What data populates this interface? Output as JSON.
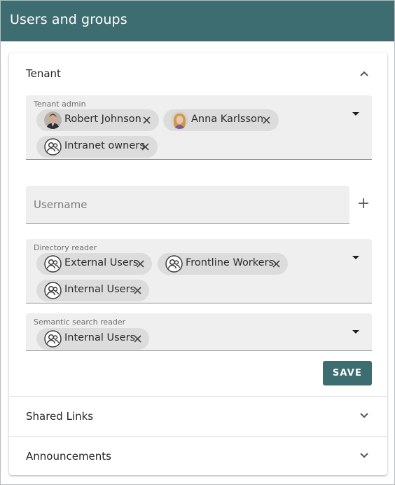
{
  "header": {
    "title": "Users and groups"
  },
  "sections": {
    "tenant": {
      "title": "Tenant",
      "tenant_admin": {
        "label": "Tenant admin",
        "chips": [
          {
            "label": "Robert Johnson",
            "type": "person"
          },
          {
            "label": "Anna Karlsson",
            "type": "person"
          },
          {
            "label": "Intranet owners",
            "type": "group"
          }
        ]
      },
      "username": {
        "placeholder": "Username",
        "value": ""
      },
      "directory_reader": {
        "label": "Directory reader",
        "chips": [
          {
            "label": "External Users",
            "type": "group"
          },
          {
            "label": "Frontline Workers",
            "type": "group"
          },
          {
            "label": "Internal Users",
            "type": "group"
          }
        ]
      },
      "semantic_search_reader": {
        "label": "Semantic search reader",
        "chips": [
          {
            "label": "Internal Users",
            "type": "group"
          }
        ]
      },
      "save_label": "SAVE"
    },
    "shared_links": {
      "title": "Shared Links"
    },
    "announcements": {
      "title": "Announcements"
    }
  },
  "icons": {
    "expand": "chevron-up-icon",
    "collapse": "chevron-down-icon",
    "add": "plus-icon",
    "remove": "close-icon",
    "group": "group-icon"
  },
  "colors": {
    "accent": "#3d6d70",
    "field_bg": "#efefef",
    "chip_bg": "#dcdcdc"
  }
}
